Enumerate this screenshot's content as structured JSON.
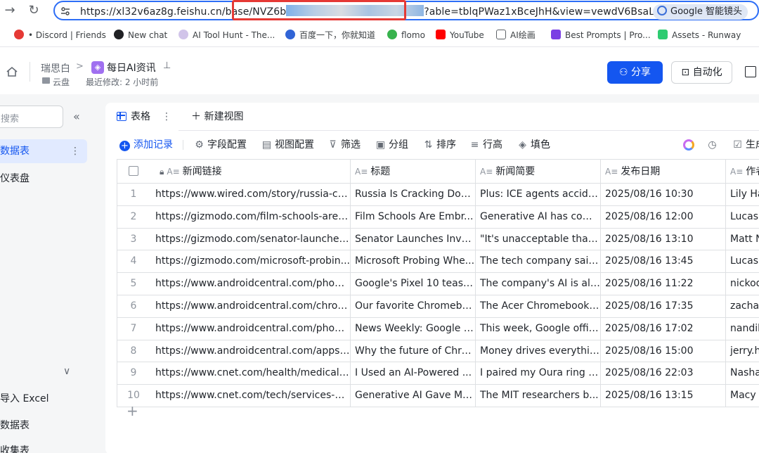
{
  "browser": {
    "url_prefix": "https://xl32v6az8g.feishu.cn/base/",
    "url_highlight_start": "NVZ6b",
    "url_suffix": "?able=tblqPWaz1xBceJhH&view=vewdV6BsaL",
    "lens_label": "Google 智能镜头",
    "bookmarks": [
      {
        "label": "• Discord | Friends",
        "icon_color": "#e53935",
        "icon": "discord-icon"
      },
      {
        "label": "New chat",
        "icon_color": "#202124",
        "icon": "openai-icon"
      },
      {
        "label": "AI Tool Hunt - The...",
        "icon_color": "#b39ddb",
        "icon": "ai-tool-hunt-icon"
      },
      {
        "label": "百度一下，你就知道",
        "icon_color": "#3064d6",
        "icon": "baidu-icon"
      },
      {
        "label": "flomo",
        "icon_color": "#37b24d",
        "icon": "flomo-icon"
      },
      {
        "label": "YouTube",
        "icon_color": "#ff0000",
        "icon": "youtube-icon"
      },
      {
        "label": "AI绘画",
        "icon_color": "#5f6368",
        "icon": "folder-icon"
      },
      {
        "label": "Best Prompts | Pro...",
        "icon_color": "#7b3fe4",
        "icon": "prompts-icon"
      },
      {
        "label": "Assets - Runway",
        "icon_color": "#2ecc71",
        "icon": "runway-icon"
      }
    ]
  },
  "header": {
    "owner": "瑞思白",
    "doc_title": "每日AI资讯",
    "folder": "云盘",
    "last_edit": "最近修改: 2 小时前",
    "share_label": "分享",
    "automation_label": "自动化"
  },
  "sidebar": {
    "search_placeholder": "搜索",
    "items": [
      {
        "label": "数据表",
        "active": true
      },
      {
        "label": "仪表盘",
        "active": false
      }
    ],
    "bottom_items": [
      {
        "label": "导入 Excel"
      },
      {
        "label": "数据表"
      },
      {
        "label": "收集表"
      }
    ]
  },
  "view": {
    "tab_label": "表格",
    "new_view_label": "新建视图",
    "toolbar": {
      "add_record": "添加记录",
      "field_config": "字段配置",
      "view_config": "视图配置",
      "filter": "筛选",
      "group": "分组",
      "sort": "排序",
      "row_height": "行高",
      "fill": "填色",
      "generate": "生成"
    }
  },
  "table": {
    "columns": [
      "新闻链接",
      "标题",
      "新闻简要",
      "发布日期",
      "作者"
    ],
    "rows": [
      {
        "n": "1",
        "link": "https://www.wired.com/story/russia-cr...",
        "title": "Russia Is Cracking Dow...",
        "summary": "Plus: ICE agents accide...",
        "date": "2025/08/16 10:30",
        "author": "Lily Ha"
      },
      {
        "n": "2",
        "link": "https://gizmodo.com/film-schools-are-...",
        "title": "Film Schools Are Embr...",
        "summary": "Generative AI has com...",
        "date": "2025/08/16 12:00",
        "author": "Lucas"
      },
      {
        "n": "3",
        "link": "https://gizmodo.com/senator-launches...",
        "title": "Senator Launches Inve...",
        "summary": "\"It's unacceptable that ...",
        "date": "2025/08/16 13:10",
        "author": "Matt N"
      },
      {
        "n": "4",
        "link": "https://gizmodo.com/microsoft-probin...",
        "title": "Microsoft Probing Whe...",
        "summary": "The tech company said...",
        "date": "2025/08/16 13:45",
        "author": "Lucas"
      },
      {
        "n": "5",
        "link": "https://www.androidcentral.com/phone...",
        "title": "Google's Pixel 10 tease...",
        "summary": "The company's AI is all ...",
        "date": "2025/08/16 11:22",
        "author": "nickod"
      },
      {
        "n": "6",
        "link": "https://www.androidcentral.com/chrom...",
        "title": "Our favorite Chromebo...",
        "summary": "The Acer Chromebook ...",
        "date": "2025/08/16 17:35",
        "author": "zacha"
      },
      {
        "n": "7",
        "link": "https://www.androidcentral.com/phone...",
        "title": "News Weekly: Google t...",
        "summary": "This week, Google offic...",
        "date": "2025/08/16 17:02",
        "author": "nandil"
      },
      {
        "n": "8",
        "link": "https://www.androidcentral.com/apps-...",
        "title": "Why the future of Chro...",
        "summary": "Money drives everythin...",
        "date": "2025/08/16 15:00",
        "author": "jerry.h"
      },
      {
        "n": "9",
        "link": "https://www.cnet.com/health/medical/i...",
        "title": "I Used an AI-Powered ...",
        "summary": "I paired my Oura ring w...",
        "date": "2025/08/16 22:03",
        "author": "Nasha"
      },
      {
        "n": "10",
        "link": "https://www.cnet.com/tech/services-a...",
        "title": "Generative AI Gave MIT...",
        "summary": "The MIT researchers b...",
        "date": "2025/08/16 13:15",
        "author": "Macy"
      }
    ]
  }
}
